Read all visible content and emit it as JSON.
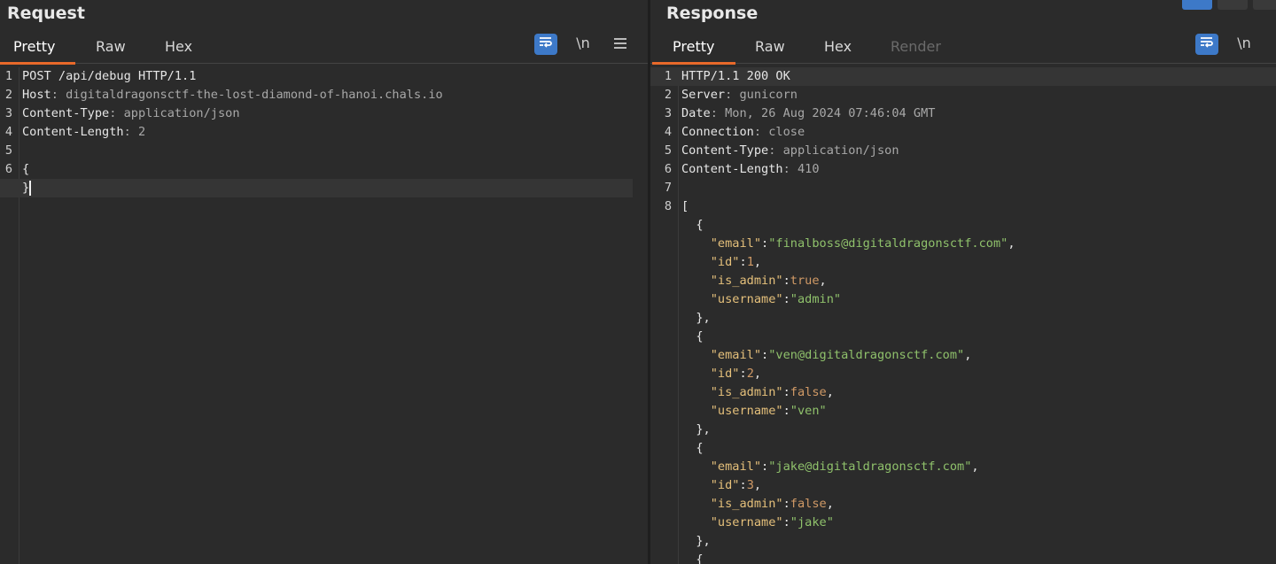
{
  "request": {
    "title": "Request",
    "tabs": [
      {
        "label": "Pretty",
        "active": true
      },
      {
        "label": "Raw",
        "active": false
      },
      {
        "label": "Hex",
        "active": false
      }
    ],
    "toolbar": {
      "wrap_icon": "wrap-lines-icon",
      "newline_label": "\\n",
      "menu_icon": "hamburger-menu-icon"
    },
    "lines": [
      {
        "n": "1",
        "t": "POST /api/debug HTTP/1.1"
      },
      {
        "n": "2",
        "t": "Host: digitaldragonsctf-the-lost-diamond-of-hanoi.chals.io"
      },
      {
        "n": "3",
        "t": "Content-Type: application/json"
      },
      {
        "n": "4",
        "t": "Content-Length: 2"
      },
      {
        "n": "5",
        "t": ""
      },
      {
        "n": "6",
        "t": "{"
      },
      {
        "n": "",
        "t": "}"
      }
    ]
  },
  "response": {
    "title": "Response",
    "tabs": [
      {
        "label": "Pretty",
        "active": true
      },
      {
        "label": "Raw",
        "active": false
      },
      {
        "label": "Hex",
        "active": false
      },
      {
        "label": "Render",
        "active": false,
        "disabled": true
      }
    ],
    "toolbar": {
      "wrap_icon": "wrap-lines-icon",
      "newline_label": "\\n"
    },
    "lines": [
      {
        "n": "1",
        "t": "HTTP/1.1 200 OK"
      },
      {
        "n": "2",
        "t": "Server: gunicorn"
      },
      {
        "n": "3",
        "t": "Date: Mon, 26 Aug 2024 07:46:04 GMT"
      },
      {
        "n": "4",
        "t": "Connection: close"
      },
      {
        "n": "5",
        "t": "Content-Type: application/json"
      },
      {
        "n": "6",
        "t": "Content-Length: 410"
      },
      {
        "n": "7",
        "t": ""
      },
      {
        "n": "8",
        "t": "["
      },
      {
        "n": "",
        "t": "  {"
      },
      {
        "n": "",
        "t": "    \"email\":\"finalboss@digitaldragonsctf.com\","
      },
      {
        "n": "",
        "t": "    \"id\":1,"
      },
      {
        "n": "",
        "t": "    \"is_admin\":true,"
      },
      {
        "n": "",
        "t": "    \"username\":\"admin\""
      },
      {
        "n": "",
        "t": "  },"
      },
      {
        "n": "",
        "t": "  {"
      },
      {
        "n": "",
        "t": "    \"email\":\"ven@digitaldragonsctf.com\","
      },
      {
        "n": "",
        "t": "    \"id\":2,"
      },
      {
        "n": "",
        "t": "    \"is_admin\":false,"
      },
      {
        "n": "",
        "t": "    \"username\":\"ven\""
      },
      {
        "n": "",
        "t": "  },"
      },
      {
        "n": "",
        "t": "  {"
      },
      {
        "n": "",
        "t": "    \"email\":\"jake@digitaldragonsctf.com\","
      },
      {
        "n": "",
        "t": "    \"id\":3,"
      },
      {
        "n": "",
        "t": "    \"is_admin\":false,"
      },
      {
        "n": "",
        "t": "    \"username\":\"jake\""
      },
      {
        "n": "",
        "t": "  },"
      },
      {
        "n": "",
        "t": "  {"
      }
    ]
  },
  "colors": {
    "accent": "#e8692a",
    "toggle_blue": "#3d79c8",
    "string": "#8fc16b",
    "number": "#d19a66",
    "json_key": "#e5c07b"
  }
}
